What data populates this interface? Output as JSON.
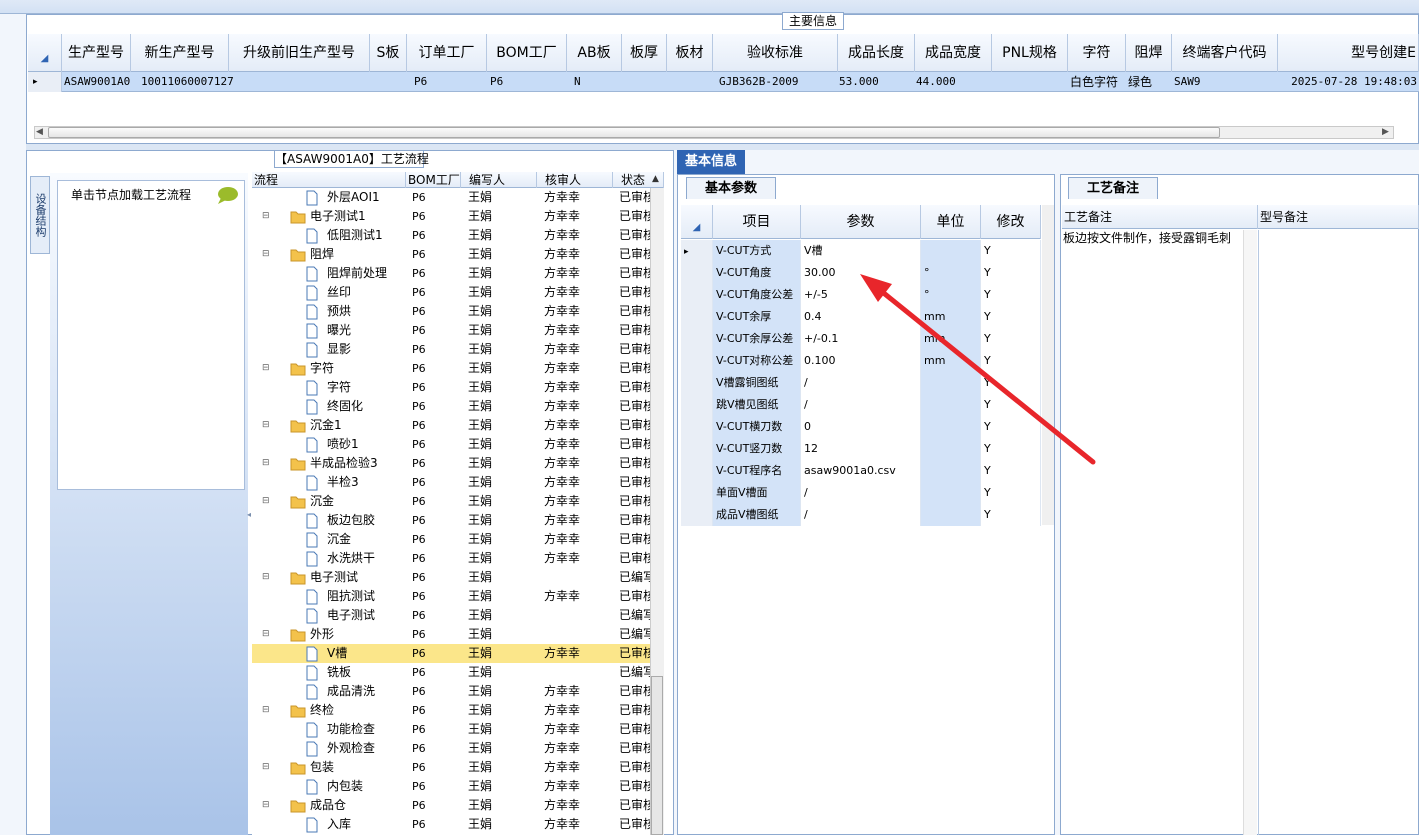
{
  "main_info": {
    "legend": "主要信息",
    "columns": [
      "生产型号",
      "新生产型号",
      "升级前旧生产型号",
      "S板",
      "订单工厂",
      "BOM工厂",
      "AB板",
      "板厚",
      "板材",
      "验收标准",
      "成品长度",
      "成品宽度",
      "PNL规格",
      "字符",
      "阻焊",
      "终端客户代码",
      "型号创建E"
    ],
    "row": {
      "marker": "▸",
      "prod_model": "ASAW9001A0",
      "new_model": "10011060007127",
      "old_model": "",
      "s_board": "",
      "order_factory": "P6",
      "bom_factory": "P6",
      "ab_board": "N",
      "thickness": "",
      "material": "",
      "standard": "GJB362B-2009",
      "length": "53.000",
      "width": "44.000",
      "pnl": "",
      "charcolor": "白色字符",
      "solder": "绿色",
      "customer": "SAW9",
      "created": "2025-07-28 19:48:03"
    }
  },
  "left": {
    "flow_title": "【ASAW9001A0】工艺流程",
    "side_tab": "设备结构",
    "node_hint": "单击节点加载工艺流程",
    "tree_headers": [
      "流程",
      "BOM工厂",
      "编写人",
      "核审人",
      "状态"
    ],
    "tree_rows": [
      {
        "name": "外层AOI1",
        "level": 2,
        "folder": false,
        "bom": "P6",
        "writer": "王娟",
        "checker": "方幸幸",
        "status": "已审核"
      },
      {
        "name": "电子测试1",
        "level": 1,
        "folder": true,
        "bom": "P6",
        "writer": "王娟",
        "checker": "方幸幸",
        "status": "已审核"
      },
      {
        "name": "低阻测试1",
        "level": 2,
        "folder": false,
        "bom": "P6",
        "writer": "王娟",
        "checker": "方幸幸",
        "status": "已审核"
      },
      {
        "name": "阻焊",
        "level": 1,
        "folder": true,
        "bom": "P6",
        "writer": "王娟",
        "checker": "方幸幸",
        "status": "已审核"
      },
      {
        "name": "阻焊前处理",
        "level": 2,
        "folder": false,
        "bom": "P6",
        "writer": "王娟",
        "checker": "方幸幸",
        "status": "已审核"
      },
      {
        "name": "丝印",
        "level": 2,
        "folder": false,
        "bom": "P6",
        "writer": "王娟",
        "checker": "方幸幸",
        "status": "已审核"
      },
      {
        "name": "预烘",
        "level": 2,
        "folder": false,
        "bom": "P6",
        "writer": "王娟",
        "checker": "方幸幸",
        "status": "已审核"
      },
      {
        "name": "曝光",
        "level": 2,
        "folder": false,
        "bom": "P6",
        "writer": "王娟",
        "checker": "方幸幸",
        "status": "已审核"
      },
      {
        "name": "显影",
        "level": 2,
        "folder": false,
        "bom": "P6",
        "writer": "王娟",
        "checker": "方幸幸",
        "status": "已审核"
      },
      {
        "name": "字符",
        "level": 1,
        "folder": true,
        "bom": "P6",
        "writer": "王娟",
        "checker": "方幸幸",
        "status": "已审核"
      },
      {
        "name": "字符",
        "level": 2,
        "folder": false,
        "bom": "P6",
        "writer": "王娟",
        "checker": "方幸幸",
        "status": "已审核"
      },
      {
        "name": "终固化",
        "level": 2,
        "folder": false,
        "bom": "P6",
        "writer": "王娟",
        "checker": "方幸幸",
        "status": "已审核"
      },
      {
        "name": "沉金1",
        "level": 1,
        "folder": true,
        "bom": "P6",
        "writer": "王娟",
        "checker": "方幸幸",
        "status": "已审核"
      },
      {
        "name": "喷砂1",
        "level": 2,
        "folder": false,
        "bom": "P6",
        "writer": "王娟",
        "checker": "方幸幸",
        "status": "已审核"
      },
      {
        "name": "半成品检验3",
        "level": 1,
        "folder": true,
        "bom": "P6",
        "writer": "王娟",
        "checker": "方幸幸",
        "status": "已审核"
      },
      {
        "name": "半检3",
        "level": 2,
        "folder": false,
        "bom": "P6",
        "writer": "王娟",
        "checker": "方幸幸",
        "status": "已审核"
      },
      {
        "name": "沉金",
        "level": 1,
        "folder": true,
        "bom": "P6",
        "writer": "王娟",
        "checker": "方幸幸",
        "status": "已审核"
      },
      {
        "name": "板边包胶",
        "level": 2,
        "folder": false,
        "bom": "P6",
        "writer": "王娟",
        "checker": "方幸幸",
        "status": "已审核"
      },
      {
        "name": "沉金",
        "level": 2,
        "folder": false,
        "bom": "P6",
        "writer": "王娟",
        "checker": "方幸幸",
        "status": "已审核"
      },
      {
        "name": "水洗烘干",
        "level": 2,
        "folder": false,
        "bom": "P6",
        "writer": "王娟",
        "checker": "方幸幸",
        "status": "已审核"
      },
      {
        "name": "电子测试",
        "level": 1,
        "folder": true,
        "bom": "P6",
        "writer": "王娟",
        "checker": "",
        "status": "已编写"
      },
      {
        "name": "阻抗测试",
        "level": 2,
        "folder": false,
        "bom": "P6",
        "writer": "王娟",
        "checker": "方幸幸",
        "status": "已审核"
      },
      {
        "name": "电子测试",
        "level": 2,
        "folder": false,
        "bom": "P6",
        "writer": "王娟",
        "checker": "",
        "status": "已编写"
      },
      {
        "name": "外形",
        "level": 1,
        "folder": true,
        "bom": "P6",
        "writer": "王娟",
        "checker": "",
        "status": "已编写"
      },
      {
        "name": "V槽",
        "level": 2,
        "folder": false,
        "bom": "P6",
        "writer": "王娟",
        "checker": "方幸幸",
        "status": "已审核",
        "selected": true
      },
      {
        "name": "铣板",
        "level": 2,
        "folder": false,
        "bom": "P6",
        "writer": "王娟",
        "checker": "",
        "status": "已编写"
      },
      {
        "name": "成品清洗",
        "level": 2,
        "folder": false,
        "bom": "P6",
        "writer": "王娟",
        "checker": "方幸幸",
        "status": "已审核"
      },
      {
        "name": "终检",
        "level": 1,
        "folder": true,
        "bom": "P6",
        "writer": "王娟",
        "checker": "方幸幸",
        "status": "已审核"
      },
      {
        "name": "功能检查",
        "level": 2,
        "folder": false,
        "bom": "P6",
        "writer": "王娟",
        "checker": "方幸幸",
        "status": "已审核"
      },
      {
        "name": "外观检查",
        "level": 2,
        "folder": false,
        "bom": "P6",
        "writer": "王娟",
        "checker": "方幸幸",
        "status": "已审核"
      },
      {
        "name": "包装",
        "level": 1,
        "folder": true,
        "bom": "P6",
        "writer": "王娟",
        "checker": "方幸幸",
        "status": "已审核"
      },
      {
        "name": "内包装",
        "level": 2,
        "folder": false,
        "bom": "P6",
        "writer": "王娟",
        "checker": "方幸幸",
        "status": "已审核"
      },
      {
        "name": "成品仓",
        "level": 1,
        "folder": true,
        "bom": "P6",
        "writer": "王娟",
        "checker": "方幸幸",
        "status": "已审核"
      },
      {
        "name": "入库",
        "level": 2,
        "folder": false,
        "bom": "P6",
        "writer": "王娟",
        "checker": "方幸幸",
        "status": "已审核"
      }
    ]
  },
  "basic": {
    "tab": "基本信息",
    "sub_tab": "基本参数",
    "headers": [
      "项目",
      "参数",
      "单位",
      "修改"
    ],
    "rows": [
      {
        "item": "V-CUT方式",
        "value": "V槽",
        "unit": "",
        "edit": "Y"
      },
      {
        "item": "V-CUT角度",
        "value": "30.00",
        "unit": "°",
        "edit": "Y"
      },
      {
        "item": "V-CUT角度公差",
        "value": "+/-5",
        "unit": "°",
        "edit": "Y"
      },
      {
        "item": "V-CUT余厚",
        "value": "0.4",
        "unit": "mm",
        "edit": "Y"
      },
      {
        "item": "V-CUT余厚公差",
        "value": "+/-0.1",
        "unit": "mm",
        "edit": "Y"
      },
      {
        "item": "V-CUT对称公差",
        "value": "0.100",
        "unit": "mm",
        "edit": "Y"
      },
      {
        "item": "V槽露铜图纸",
        "value": "/",
        "unit": "",
        "edit": "Y"
      },
      {
        "item": "跳V槽见图纸",
        "value": "/",
        "unit": "",
        "edit": "Y"
      },
      {
        "item": "V-CUT横刀数",
        "value": "0",
        "unit": "",
        "edit": "Y"
      },
      {
        "item": "V-CUT竖刀数",
        "value": "12",
        "unit": "",
        "edit": "Y"
      },
      {
        "item": "V-CUT程序名",
        "value": "asaw9001a0.csv",
        "unit": "",
        "edit": "Y"
      },
      {
        "item": "单面V槽面",
        "value": "/",
        "unit": "",
        "edit": "Y"
      },
      {
        "item": "成品V槽图纸",
        "value": "/",
        "unit": "",
        "edit": "Y"
      }
    ]
  },
  "notes": {
    "tab": "工艺备注",
    "col1": "工艺备注",
    "col2": "型号备注",
    "text": "板边按文件制作，接受露铜毛刺"
  },
  "colors": {
    "accent": "#2f64b3",
    "selected_row": "#c7dcf7",
    "tree_selected": "#fbe68a",
    "arrow": "#e8262b"
  }
}
